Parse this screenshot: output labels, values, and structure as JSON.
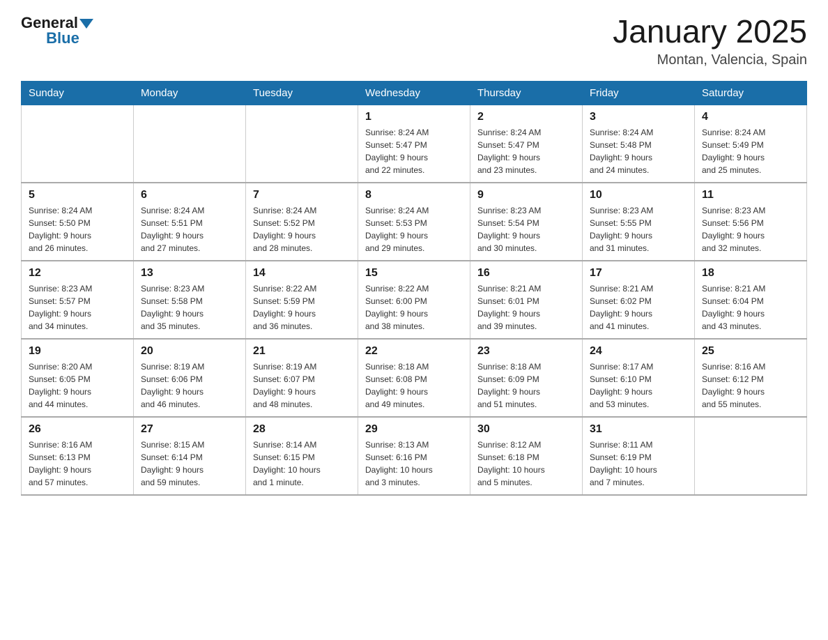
{
  "header": {
    "logo_general": "General",
    "logo_blue": "Blue",
    "title": "January 2025",
    "subtitle": "Montan, Valencia, Spain"
  },
  "days_of_week": [
    "Sunday",
    "Monday",
    "Tuesday",
    "Wednesday",
    "Thursday",
    "Friday",
    "Saturday"
  ],
  "weeks": [
    [
      {
        "day": "",
        "info": ""
      },
      {
        "day": "",
        "info": ""
      },
      {
        "day": "",
        "info": ""
      },
      {
        "day": "1",
        "info": "Sunrise: 8:24 AM\nSunset: 5:47 PM\nDaylight: 9 hours\nand 22 minutes."
      },
      {
        "day": "2",
        "info": "Sunrise: 8:24 AM\nSunset: 5:47 PM\nDaylight: 9 hours\nand 23 minutes."
      },
      {
        "day": "3",
        "info": "Sunrise: 8:24 AM\nSunset: 5:48 PM\nDaylight: 9 hours\nand 24 minutes."
      },
      {
        "day": "4",
        "info": "Sunrise: 8:24 AM\nSunset: 5:49 PM\nDaylight: 9 hours\nand 25 minutes."
      }
    ],
    [
      {
        "day": "5",
        "info": "Sunrise: 8:24 AM\nSunset: 5:50 PM\nDaylight: 9 hours\nand 26 minutes."
      },
      {
        "day": "6",
        "info": "Sunrise: 8:24 AM\nSunset: 5:51 PM\nDaylight: 9 hours\nand 27 minutes."
      },
      {
        "day": "7",
        "info": "Sunrise: 8:24 AM\nSunset: 5:52 PM\nDaylight: 9 hours\nand 28 minutes."
      },
      {
        "day": "8",
        "info": "Sunrise: 8:24 AM\nSunset: 5:53 PM\nDaylight: 9 hours\nand 29 minutes."
      },
      {
        "day": "9",
        "info": "Sunrise: 8:23 AM\nSunset: 5:54 PM\nDaylight: 9 hours\nand 30 minutes."
      },
      {
        "day": "10",
        "info": "Sunrise: 8:23 AM\nSunset: 5:55 PM\nDaylight: 9 hours\nand 31 minutes."
      },
      {
        "day": "11",
        "info": "Sunrise: 8:23 AM\nSunset: 5:56 PM\nDaylight: 9 hours\nand 32 minutes."
      }
    ],
    [
      {
        "day": "12",
        "info": "Sunrise: 8:23 AM\nSunset: 5:57 PM\nDaylight: 9 hours\nand 34 minutes."
      },
      {
        "day": "13",
        "info": "Sunrise: 8:23 AM\nSunset: 5:58 PM\nDaylight: 9 hours\nand 35 minutes."
      },
      {
        "day": "14",
        "info": "Sunrise: 8:22 AM\nSunset: 5:59 PM\nDaylight: 9 hours\nand 36 minutes."
      },
      {
        "day": "15",
        "info": "Sunrise: 8:22 AM\nSunset: 6:00 PM\nDaylight: 9 hours\nand 38 minutes."
      },
      {
        "day": "16",
        "info": "Sunrise: 8:21 AM\nSunset: 6:01 PM\nDaylight: 9 hours\nand 39 minutes."
      },
      {
        "day": "17",
        "info": "Sunrise: 8:21 AM\nSunset: 6:02 PM\nDaylight: 9 hours\nand 41 minutes."
      },
      {
        "day": "18",
        "info": "Sunrise: 8:21 AM\nSunset: 6:04 PM\nDaylight: 9 hours\nand 43 minutes."
      }
    ],
    [
      {
        "day": "19",
        "info": "Sunrise: 8:20 AM\nSunset: 6:05 PM\nDaylight: 9 hours\nand 44 minutes."
      },
      {
        "day": "20",
        "info": "Sunrise: 8:19 AM\nSunset: 6:06 PM\nDaylight: 9 hours\nand 46 minutes."
      },
      {
        "day": "21",
        "info": "Sunrise: 8:19 AM\nSunset: 6:07 PM\nDaylight: 9 hours\nand 48 minutes."
      },
      {
        "day": "22",
        "info": "Sunrise: 8:18 AM\nSunset: 6:08 PM\nDaylight: 9 hours\nand 49 minutes."
      },
      {
        "day": "23",
        "info": "Sunrise: 8:18 AM\nSunset: 6:09 PM\nDaylight: 9 hours\nand 51 minutes."
      },
      {
        "day": "24",
        "info": "Sunrise: 8:17 AM\nSunset: 6:10 PM\nDaylight: 9 hours\nand 53 minutes."
      },
      {
        "day": "25",
        "info": "Sunrise: 8:16 AM\nSunset: 6:12 PM\nDaylight: 9 hours\nand 55 minutes."
      }
    ],
    [
      {
        "day": "26",
        "info": "Sunrise: 8:16 AM\nSunset: 6:13 PM\nDaylight: 9 hours\nand 57 minutes."
      },
      {
        "day": "27",
        "info": "Sunrise: 8:15 AM\nSunset: 6:14 PM\nDaylight: 9 hours\nand 59 minutes."
      },
      {
        "day": "28",
        "info": "Sunrise: 8:14 AM\nSunset: 6:15 PM\nDaylight: 10 hours\nand 1 minute."
      },
      {
        "day": "29",
        "info": "Sunrise: 8:13 AM\nSunset: 6:16 PM\nDaylight: 10 hours\nand 3 minutes."
      },
      {
        "day": "30",
        "info": "Sunrise: 8:12 AM\nSunset: 6:18 PM\nDaylight: 10 hours\nand 5 minutes."
      },
      {
        "day": "31",
        "info": "Sunrise: 8:11 AM\nSunset: 6:19 PM\nDaylight: 10 hours\nand 7 minutes."
      },
      {
        "day": "",
        "info": ""
      }
    ]
  ]
}
